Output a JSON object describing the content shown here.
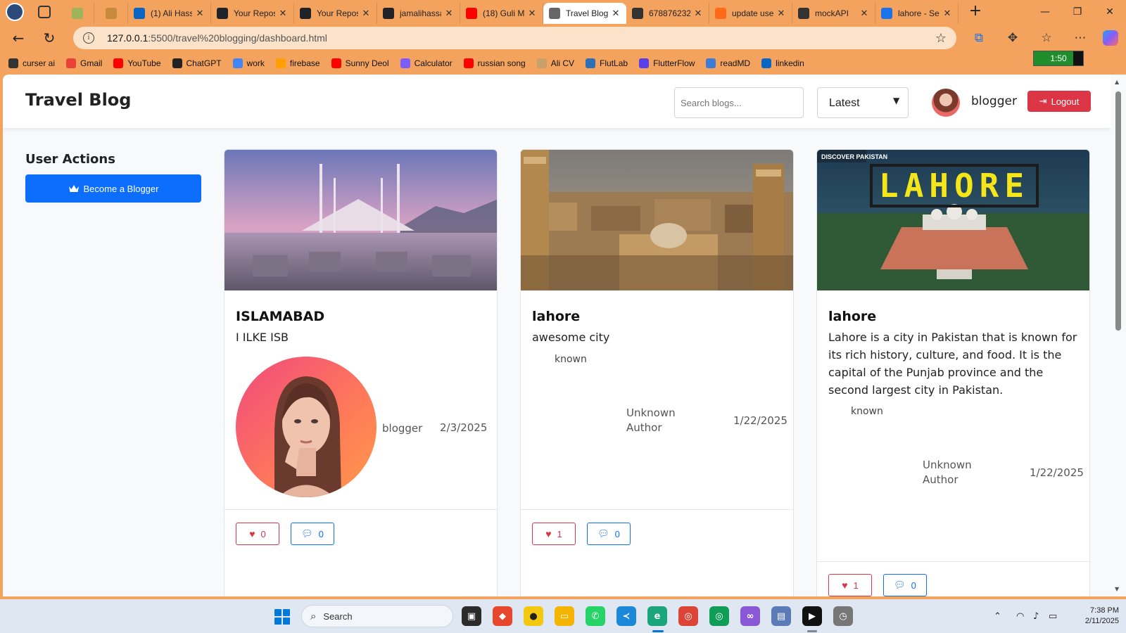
{
  "browser": {
    "tabs": [
      {
        "title": "",
        "icon": "green-extension-icon",
        "color": "#9fb35a",
        "pinned": true
      },
      {
        "title": "",
        "icon": "orange-circle-icon",
        "color": "#c98a3d",
        "pinned": true
      },
      {
        "title": "(1) Ali Hass",
        "icon": "linkedin-icon",
        "color": "#0a66c2"
      },
      {
        "title": "Your Repos",
        "icon": "github-icon",
        "color": "#1f2328"
      },
      {
        "title": "Your Repos",
        "icon": "github-icon",
        "color": "#1f2328"
      },
      {
        "title": "jamalihassa",
        "icon": "github-icon",
        "color": "#1f2328"
      },
      {
        "title": "(18) Guli M",
        "icon": "youtube-icon",
        "color": "#ff0000"
      },
      {
        "title": "Travel Blog",
        "icon": "page-icon",
        "color": "#666666",
        "active": true
      },
      {
        "title": "678876232",
        "icon": "mockapi-icon",
        "color": "#333333"
      },
      {
        "title": "update use",
        "icon": "orange-dot-icon",
        "color": "#ff6a1a"
      },
      {
        "title": "mockAPI",
        "icon": "mockapi-icon",
        "color": "#333333"
      },
      {
        "title": "lahore - Se",
        "icon": "search-icon",
        "color": "#1a73e8"
      }
    ],
    "url_host": "127.0.0.1",
    "url_path": ":5500/travel%20blogging/dashboard.html",
    "bookmarks": [
      {
        "label": "curser ai",
        "icon": "cursor-icon",
        "color": "#333333"
      },
      {
        "label": "Gmail",
        "icon": "gmail-icon",
        "color": "#ea4335"
      },
      {
        "label": "YouTube",
        "icon": "youtube-icon",
        "color": "#ff0000"
      },
      {
        "label": "ChatGPT",
        "icon": "chatgpt-icon",
        "color": "#222222"
      },
      {
        "label": "work",
        "icon": "docs-icon",
        "color": "#4285f4"
      },
      {
        "label": "firebase",
        "icon": "firebase-icon",
        "color": "#ffa000"
      },
      {
        "label": "Sunny Deol",
        "icon": "youtube-icon",
        "color": "#ff0000"
      },
      {
        "label": "Calculator",
        "icon": "calculator-icon",
        "color": "#7b5cff"
      },
      {
        "label": "russian song",
        "icon": "youtube-icon",
        "color": "#ff0000"
      },
      {
        "label": "Ali CV",
        "icon": "cv-icon",
        "color": "#c9a06a"
      },
      {
        "label": "FlutLab",
        "icon": "flutlab-icon",
        "color": "#2d6fb5"
      },
      {
        "label": "FlutterFlow",
        "icon": "flutterflow-icon",
        "color": "#5a3ee8"
      },
      {
        "label": "readMD",
        "icon": "readmd-icon",
        "color": "#3d7bd9"
      },
      {
        "label": "linkedin",
        "icon": "linkedin-icon",
        "color": "#0a66c2"
      }
    ],
    "battery_time": "1:50",
    "battery_level": 0.8
  },
  "site": {
    "brand": "Travel Blog",
    "search_placeholder": "Search blogs...",
    "sort_selected": "Latest",
    "username": "blogger",
    "logout_label": "Logout"
  },
  "sidebar": {
    "title": "User Actions",
    "become_label": "Become a Blogger"
  },
  "posts": [
    {
      "title": "ISLAMABAD",
      "description": "I ILKE ISB",
      "author": "blogger",
      "date": "2/3/2025",
      "likes": "0",
      "comments": "0",
      "image": "faisal-mosque-image",
      "author_avatar": "author-photo"
    },
    {
      "title": "lahore",
      "description": "awesome city",
      "broken_alt": "known",
      "author": "Unknown Author",
      "date": "1/22/2025",
      "likes": "1",
      "comments": "0",
      "image": "walled-city-image"
    },
    {
      "title": "lahore",
      "description": "Lahore is a city in Pakistan that is known for its rich history, culture, and food. It is the capital of the Punjab province and the second largest city in Pakistan.",
      "broken_alt": "known",
      "author": "Unknown Author",
      "date": "1/22/2025",
      "likes": "1",
      "comments": "0",
      "image": "discover-pakistan-lahore-image",
      "image_brand": "DISCOVER PAKISTAN",
      "image_text": "LAHORE"
    }
  ],
  "taskbar": {
    "search_label": "Search",
    "time": "7:38 PM",
    "date": "2/11/2025"
  }
}
